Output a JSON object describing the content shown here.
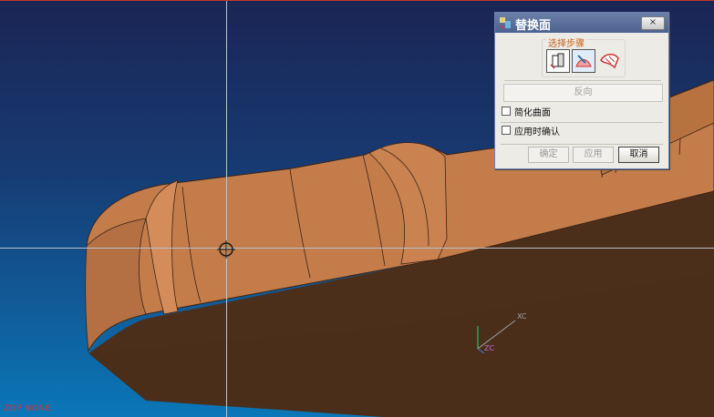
{
  "dialog": {
    "title": "替换面",
    "close_label": "×",
    "steps_label": "选择步骤",
    "step_icons": [
      "surface-select-icon",
      "surface-replace-icon",
      "quilt-icon"
    ],
    "reverse_label": "反向",
    "options": [
      {
        "label": "简化曲面",
        "checked": false
      },
      {
        "label": "应用时确认",
        "checked": false
      }
    ],
    "ok_label": "确定",
    "apply_label": "应用",
    "cancel_label": "取消"
  },
  "viewport": {
    "axis_x_label": "XC",
    "axis_z_label": "ZC",
    "status_text": "ZOP NONE",
    "model_colors": {
      "top": "#c07848",
      "side": "#4a2e1a",
      "edge": "#3a2414"
    }
  }
}
